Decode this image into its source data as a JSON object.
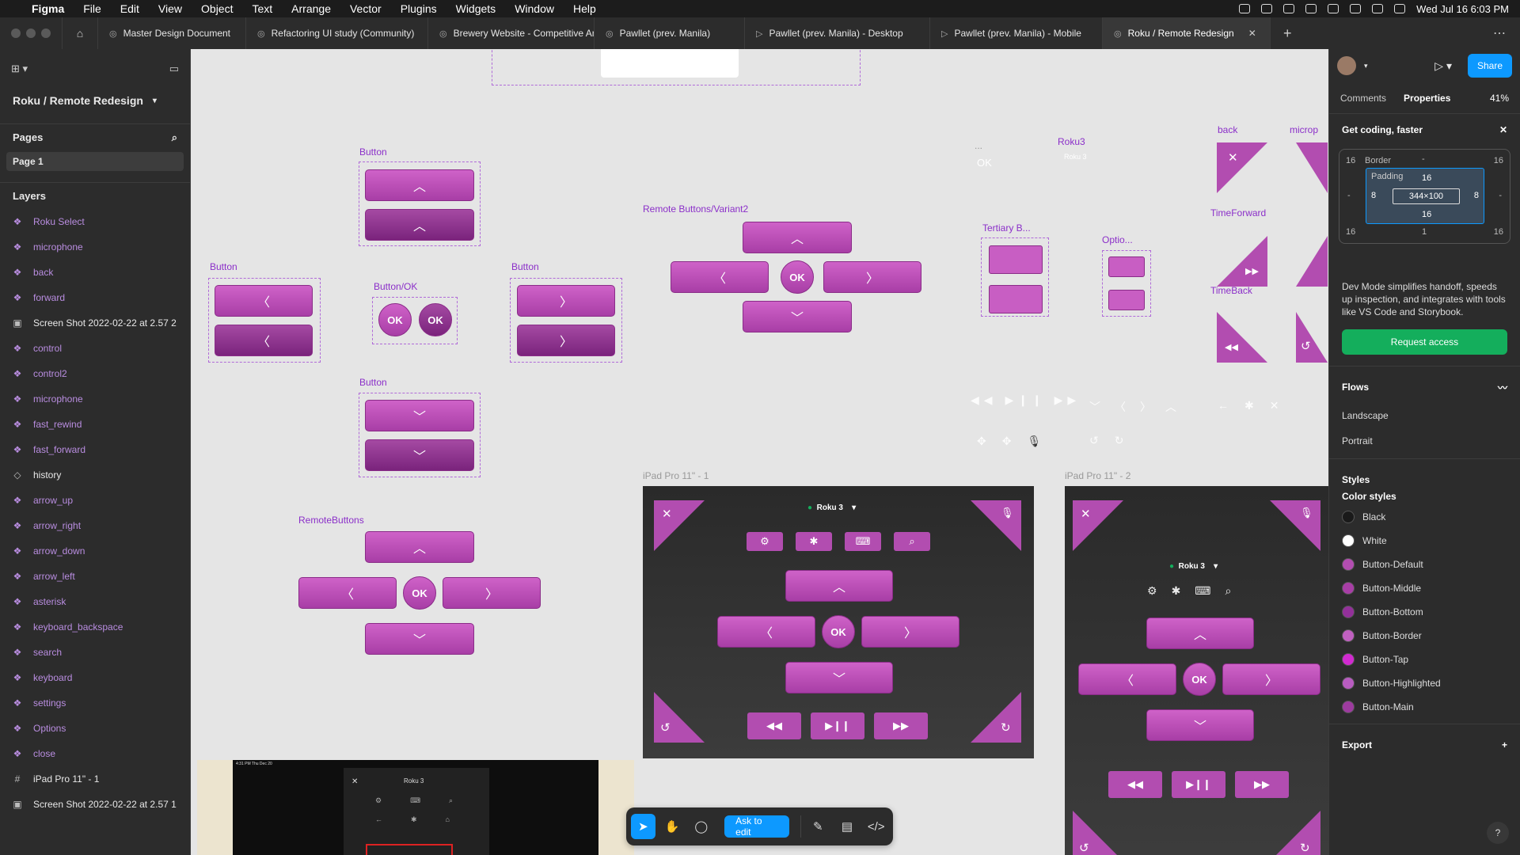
{
  "menubar": {
    "app": "Figma",
    "items": [
      "File",
      "Edit",
      "View",
      "Object",
      "Text",
      "Arrange",
      "Vector",
      "Plugins",
      "Widgets",
      "Window",
      "Help"
    ],
    "clock": "Wed Jul 16  6:03 PM"
  },
  "tabs": [
    {
      "label": "Master Design Document"
    },
    {
      "label": "Refactoring UI study (Community)"
    },
    {
      "label": "Brewery Website - Competitive An"
    },
    {
      "label": "Pawllet (prev. Manila)"
    },
    {
      "label": "Pawllet (prev. Manila) - Desktop"
    },
    {
      "label": "Pawllet (prev. Manila) - Mobile"
    },
    {
      "label": "Roku / Remote Redesign"
    }
  ],
  "left_panel": {
    "file_title": "Roku / Remote Redesign",
    "pages_title": "Pages",
    "page": "Page 1",
    "layers_title": "Layers",
    "layers": [
      {
        "name": "Roku Select",
        "kind": "component"
      },
      {
        "name": "microphone",
        "kind": "component"
      },
      {
        "name": "back",
        "kind": "component"
      },
      {
        "name": "forward",
        "kind": "component"
      },
      {
        "name": "Screen Shot 2022-02-22 at 2.57 2",
        "kind": "image"
      },
      {
        "name": "control",
        "kind": "component"
      },
      {
        "name": "control2",
        "kind": "component"
      },
      {
        "name": "microphone",
        "kind": "component"
      },
      {
        "name": "fast_rewind",
        "kind": "component"
      },
      {
        "name": "fast_forward",
        "kind": "component"
      },
      {
        "name": "history",
        "kind": "instance"
      },
      {
        "name": "arrow_up",
        "kind": "component"
      },
      {
        "name": "arrow_right",
        "kind": "component"
      },
      {
        "name": "arrow_down",
        "kind": "component"
      },
      {
        "name": "arrow_left",
        "kind": "component"
      },
      {
        "name": "asterisk",
        "kind": "component"
      },
      {
        "name": "keyboard_backspace",
        "kind": "component"
      },
      {
        "name": "search",
        "kind": "component"
      },
      {
        "name": "keyboard",
        "kind": "component"
      },
      {
        "name": "settings",
        "kind": "component"
      },
      {
        "name": "Options",
        "kind": "component"
      },
      {
        "name": "close",
        "kind": "component"
      },
      {
        "name": "iPad Pro 11\" - 1",
        "kind": "frame"
      },
      {
        "name": "Screen Shot 2022-02-22 at 2.57 1",
        "kind": "image"
      }
    ]
  },
  "canvas": {
    "labels": {
      "button_top": "Button",
      "button_left": "Button",
      "button_ok": "Button/OK",
      "button_right": "Button",
      "button_down": "Button",
      "remote_variant": "Remote Buttons/Variant2",
      "remote_buttons": "RemoteButtons",
      "tertiary": "Tertiary B...",
      "options": "Optio...",
      "roku3": "Roku3",
      "roku3_sub": "Roku 3",
      "back": "back",
      "microphone": "microp",
      "timeforward": "TimeForward",
      "timeback": "TimeBack",
      "ipad1": "iPad Pro 11\" - 1",
      "ipad2": "iPad Pro 11\" - 2",
      "dots": "...",
      "ok_ghost": "OK",
      "ok": "OK"
    },
    "ipad_title": "Roku 3",
    "shot_status_left": "4:31 PM   Thu Dec 20",
    "shot_title": "Roku 3"
  },
  "toolbar": {
    "ask": "Ask to edit"
  },
  "right_panel": {
    "share": "Share",
    "tabs": {
      "comments": "Comments",
      "properties": "Properties",
      "zoom": "41%"
    },
    "banner_title": "Get coding, faster",
    "box": {
      "border": "Border",
      "dash": "-",
      "padding": "Padding",
      "top": "16",
      "left": "8",
      "right": "8",
      "bottom": "16",
      "size": "344×100",
      "outer_tl": "16",
      "outer_tr": "16",
      "outer_bl": "16",
      "outer_br": "16",
      "outer_b": "1"
    },
    "dm_text": "Dev Mode simplifies handoff, speeds up inspection, and integrates with tools like VS Code and Storybook.",
    "request": "Request access",
    "flows_title": "Flows",
    "flows": [
      "Landscape",
      "Portrait"
    ],
    "styles_title": "Styles",
    "color_styles_title": "Color styles",
    "colors": [
      {
        "name": "Black",
        "hex": "#1a1a1a"
      },
      {
        "name": "White",
        "hex": "#ffffff"
      },
      {
        "name": "Button-Default",
        "hex": "#b24db0"
      },
      {
        "name": "Button-Middle",
        "hex": "#a83ea6"
      },
      {
        "name": "Button-Bottom",
        "hex": "#93309a"
      },
      {
        "name": "Button-Border",
        "hex": "#c060c0"
      },
      {
        "name": "Button-Tap",
        "hex": "#d12ad0"
      },
      {
        "name": "Button-Highlighted",
        "hex": "#b85cc0"
      },
      {
        "name": "Button-Main",
        "hex": "#9d3b9f"
      }
    ],
    "export_title": "Export"
  }
}
